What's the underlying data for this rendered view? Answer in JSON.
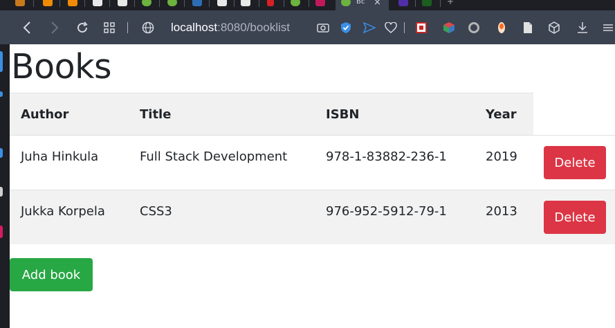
{
  "browser": {
    "url_host": "localhost",
    "url_path": ":8080/booklist",
    "active_tab_title": "Bc",
    "accent": "#3b4250"
  },
  "page": {
    "title": "Books",
    "columns": [
      "Author",
      "Title",
      "ISBN",
      "Year"
    ],
    "books": [
      {
        "author": "Juha Hinkula",
        "title": "Full Stack Development",
        "isbn": "978-1-83882-236-1",
        "year": "2019",
        "action": "Delete"
      },
      {
        "author": "Jukka Korpela",
        "title": "CSS3",
        "isbn": "976-952-5912-79-1",
        "year": "2013",
        "action": "Delete"
      }
    ],
    "add_button": "Add book"
  },
  "colors": {
    "delete": "#dc3545",
    "add": "#28a745",
    "header_bg": "#f1f1f1",
    "stripe": "#f2f2f2"
  }
}
